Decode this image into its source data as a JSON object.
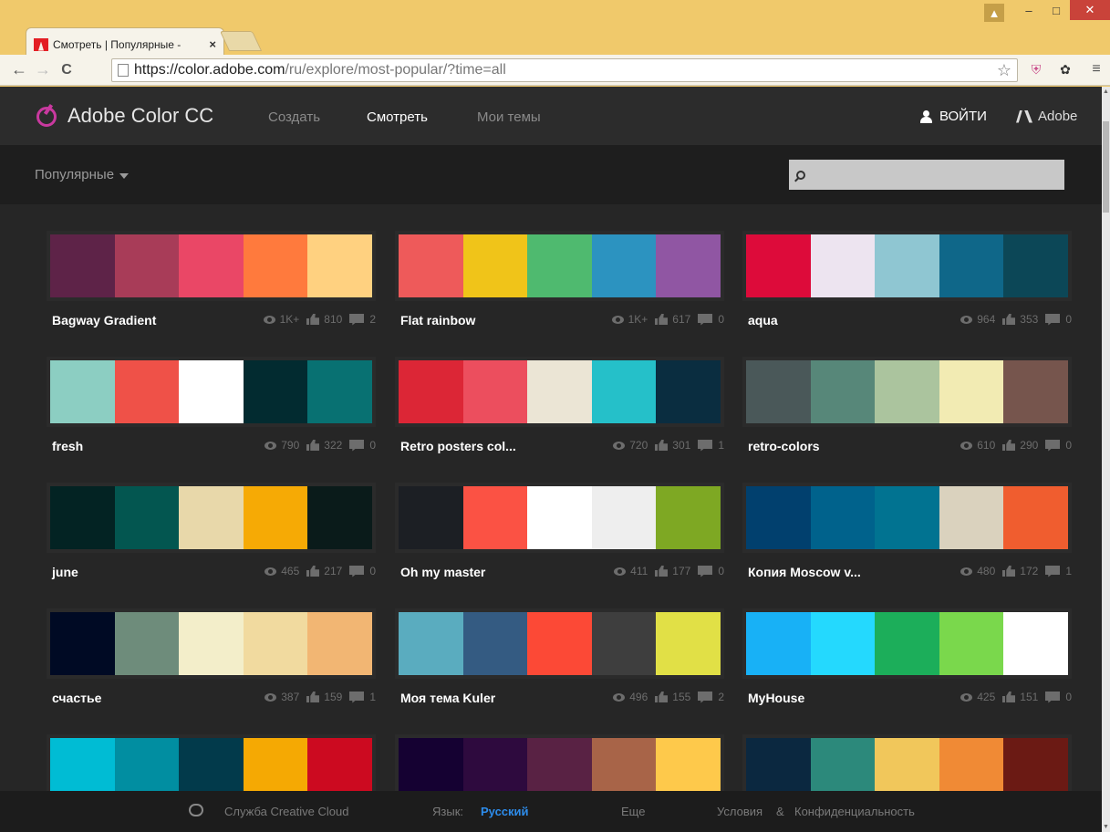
{
  "browser": {
    "tab_title": "Смотреть | Популярные -",
    "tab_close": "×",
    "url_host": "https://color.adobe.com",
    "url_path": "/ru/explore/most-popular/?time=all",
    "back": "←",
    "forward": "→",
    "reload": "C",
    "star": "☆",
    "win_user": "▲",
    "win_min": "‒",
    "win_max": "□",
    "win_close": "✕",
    "menu": "≡"
  },
  "header": {
    "brand": "Adobe Color CC",
    "nav": {
      "create": "Создать",
      "view": "Смотреть",
      "mine": "Мои темы"
    },
    "login": "ВОЙТИ",
    "adobe": "Adobe"
  },
  "filter": {
    "selected": "Популярные",
    "search_placeholder": ""
  },
  "themes": [
    {
      "name": "Bagway Gradient",
      "views": "1K+",
      "likes": "810",
      "comments": "2",
      "colors": [
        "#5e2348",
        "#a83c58",
        "#ea4766",
        "#ff7a3d",
        "#ffd180"
      ]
    },
    {
      "name": "Flat rainbow",
      "views": "1K+",
      "likes": "617",
      "comments": "0",
      "colors": [
        "#ee5a5a",
        "#f0c419",
        "#4fba6f",
        "#2c93c0",
        "#9056a3"
      ]
    },
    {
      "name": "aqua",
      "views": "964",
      "likes": "353",
      "comments": "0",
      "colors": [
        "#dd0b3a",
        "#ede4f0",
        "#8fc6d2",
        "#0f6789",
        "#0c4757"
      ]
    },
    {
      "name": "fresh",
      "views": "790",
      "likes": "322",
      "comments": "0",
      "colors": [
        "#8ccec2",
        "#ef5148",
        "#ffffff",
        "#022b30",
        "#087172"
      ]
    },
    {
      "name": "Retro posters col...",
      "views": "720",
      "likes": "301",
      "comments": "1",
      "colors": [
        "#dc2636",
        "#ec4e5e",
        "#ebe5d5",
        "#25c0c9",
        "#0a2d40"
      ]
    },
    {
      "name": "retro-colors",
      "views": "610",
      "likes": "290",
      "comments": "0",
      "colors": [
        "#4a5859",
        "#578779",
        "#abc49e",
        "#f2ebb3",
        "#76554d"
      ]
    },
    {
      "name": "june",
      "views": "465",
      "likes": "217",
      "comments": "0",
      "colors": [
        "#032323",
        "#035650",
        "#e8d8aa",
        "#f6aa05",
        "#0a1b1a"
      ]
    },
    {
      "name": "Oh my master",
      "views": "411",
      "likes": "177",
      "comments": "0",
      "colors": [
        "#1c1f24",
        "#fb5244",
        "#ffffff",
        "#eeeeee",
        "#7ea823"
      ]
    },
    {
      "name": "Копия Moscow v...",
      "views": "480",
      "likes": "172",
      "comments": "1",
      "colors": [
        "#01406e",
        "#00628c",
        "#017391",
        "#dad2be",
        "#f05d2f"
      ]
    },
    {
      "name": "счастье",
      "views": "387",
      "likes": "159",
      "comments": "1",
      "colors": [
        "#000a24",
        "#6e8c7b",
        "#f3eeca",
        "#f1da9f",
        "#f2b673"
      ]
    },
    {
      "name": "Моя тема Kuler",
      "views": "496",
      "likes": "155",
      "comments": "2",
      "colors": [
        "#5aacbf",
        "#345b82",
        "#fc4936",
        "#3e3e3e",
        "#e1e046"
      ]
    },
    {
      "name": "MyHouse",
      "views": "425",
      "likes": "151",
      "comments": "0",
      "colors": [
        "#18b1f6",
        "#24d9fe",
        "#1cae5a",
        "#7ad84c",
        "#ffffff"
      ]
    },
    {
      "name": "",
      "views": "",
      "likes": "",
      "comments": "",
      "colors": [
        "#00bcd4",
        "#018ea1",
        "#023a4b",
        "#f5a903",
        "#cc0a20"
      ]
    },
    {
      "name": "",
      "views": "",
      "likes": "",
      "comments": "",
      "colors": [
        "#150132",
        "#2e0a3e",
        "#592244",
        "#a86448",
        "#fec94b"
      ]
    },
    {
      "name": "",
      "views": "",
      "likes": "",
      "comments": "",
      "colors": [
        "#0b2840",
        "#2c897b",
        "#f1c75b",
        "#f08a35",
        "#6b1a14"
      ]
    }
  ],
  "footer": {
    "cc": "Служба Creative Cloud",
    "lang_label": "Язык:",
    "lang_value": "Русский",
    "more": "Еще",
    "terms": "Условия",
    "amp": "&",
    "privacy": "Конфиденциальность"
  }
}
